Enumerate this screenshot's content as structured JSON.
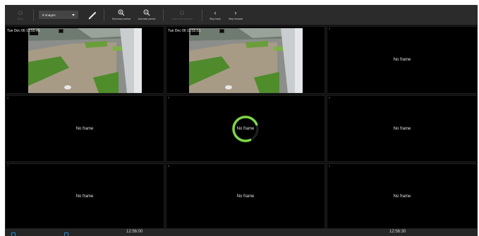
{
  "toolbar": {
    "back_label": "Back",
    "images_select": "9 images",
    "decrease_period_label": "Decrease period",
    "increase_period_label": "Increase period",
    "video_view_label": "Video view session",
    "step_back_label": "Step back",
    "step_forward_label": "Step forward"
  },
  "cells": [
    {
      "num": "",
      "timestamp": "Tue Dec 06 12:55:45",
      "state": "image"
    },
    {
      "num": "",
      "timestamp": "Tue Dec 06 12:55:51",
      "state": "image"
    },
    {
      "num": "3",
      "text": "No frame",
      "state": "empty"
    },
    {
      "num": "4",
      "text": "No frame",
      "state": "empty"
    },
    {
      "num": "5",
      "text": "No frame",
      "state": "loading"
    },
    {
      "num": "6",
      "text": "No frame",
      "state": "empty"
    },
    {
      "num": "7",
      "text": "No frame",
      "state": "empty"
    },
    {
      "num": "8",
      "text": "No frame",
      "state": "empty"
    },
    {
      "num": "9",
      "text": "No frame",
      "state": "empty"
    }
  ],
  "timeline": {
    "time_left": "12:56:00",
    "time_right": "12:56:30"
  },
  "colors": {
    "spinner": "#7fd54a",
    "timeline_marker": "#1c8ad0"
  }
}
